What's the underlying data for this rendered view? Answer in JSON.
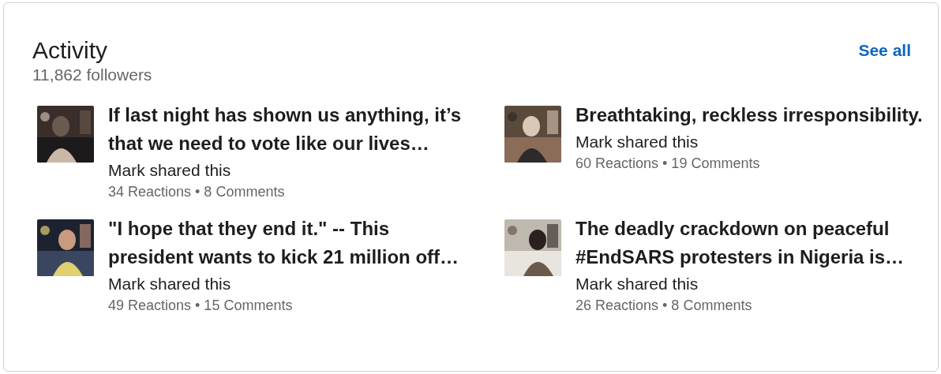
{
  "header": {
    "title": "Activity",
    "followers": "11,862 followers",
    "see_all": "See all"
  },
  "posts": [
    {
      "title": "If last night has shown us anything, it’s that we need to vote like our lives…",
      "byline": "Mark shared this",
      "stats": "34 Reactions • 8 Comments",
      "kind": "picture"
    },
    {
      "title": "Breathtaking, reckless irresponsibility.",
      "byline": "Mark shared this",
      "stats": "60 Reactions • 19 Comments",
      "kind": "picture"
    },
    {
      "title": "\"I hope that they end it.\" -- This president wants to kick 21 million off…",
      "byline": "Mark shared this",
      "stats": "49 Reactions • 15 Comments",
      "kind": "picture"
    },
    {
      "title": "The deadly crackdown on peaceful #EndSARS protesters in Nigeria is…",
      "byline": "Mark shared this",
      "stats": "26 Reactions • 8 Comments",
      "kind": "picture"
    }
  ]
}
